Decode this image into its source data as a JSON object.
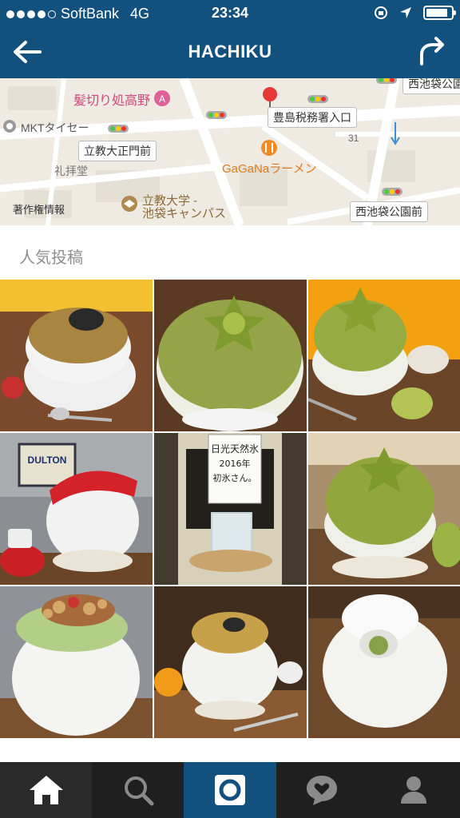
{
  "status_bar": {
    "carrier": "SoftBank",
    "network": "4G",
    "time": "23:34"
  },
  "nav": {
    "title": "HACHIKU",
    "back_icon": "back-arrow-icon",
    "share_icon": "share-arrow-icon"
  },
  "map": {
    "labels": {
      "barber": "髪切り処高野",
      "mkt": "MKTタイセー",
      "tax_office": "豊島税務署入口",
      "rikkyo_gate": "立教大正門前",
      "chapel": "礼拝堂",
      "ramen": "GaGaNaラーメン",
      "rikkyo_campus_1": "立教大学 -",
      "rikkyo_campus_2": "池袋キャンパス",
      "copyright": "著作権情報",
      "park_front": "西池袋公園前",
      "park_top": "西池袋公園",
      "block_num": "31"
    }
  },
  "section": {
    "title": "人気投稿"
  },
  "posts": [
    {
      "kind": "kinako",
      "description_icon": "photo"
    },
    {
      "kind": "kiwi_star",
      "description_icon": "photo"
    },
    {
      "kind": "kiwi_tray",
      "description_icon": "photo"
    },
    {
      "kind": "strawberry",
      "description_icon": "photo",
      "sign_text": "DULTON"
    },
    {
      "kind": "ice_block",
      "description_icon": "photo",
      "sign_text": "日光天然氷 2016年 初氷さん。"
    },
    {
      "kind": "kiwi_plate",
      "description_icon": "photo"
    },
    {
      "kind": "pistachio_nuts",
      "description_icon": "photo"
    },
    {
      "kind": "kinako_sesame",
      "description_icon": "photo"
    },
    {
      "kind": "matcha_hole",
      "description_icon": "photo"
    }
  ],
  "tabbar": {
    "items": [
      "home-icon",
      "search-icon",
      "camera-icon",
      "activity-icon",
      "profile-icon"
    ]
  },
  "colors": {
    "brand": "#12507e",
    "tabbar": "#1f1f1f"
  }
}
